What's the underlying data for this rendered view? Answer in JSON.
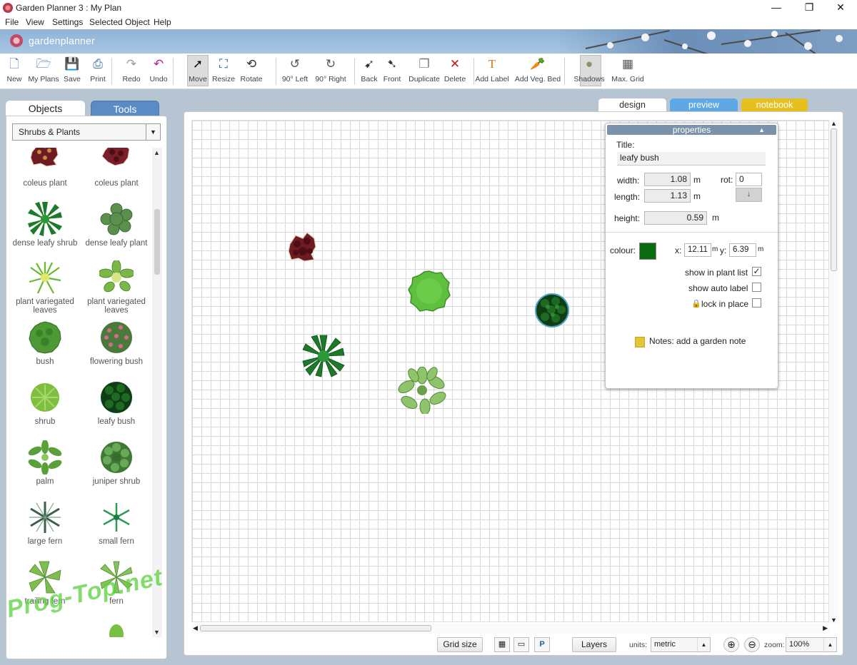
{
  "window": {
    "title": "Garden Planner 3 : My  Plan",
    "minimize": "—",
    "maximize": "❐",
    "close": "✕"
  },
  "menu": [
    "File",
    "View",
    "Settings",
    "Selected Object",
    "Help"
  ],
  "brand": {
    "logo_text": "gardenplanner"
  },
  "toolbar": [
    {
      "label": "New",
      "icon": "new-document-icon",
      "glyph": "🗋"
    },
    {
      "label": "My Plans",
      "icon": "folder-icon",
      "glyph": "🗁"
    },
    {
      "label": "Save",
      "icon": "save-icon",
      "glyph": "💾"
    },
    {
      "label": "Print",
      "icon": "print-icon",
      "glyph": "⎙"
    },
    {
      "label": "Redo",
      "icon": "redo-icon",
      "glyph": "↷"
    },
    {
      "label": "Undo",
      "icon": "undo-icon",
      "glyph": "↶"
    },
    {
      "label": "Move",
      "icon": "move-cursor-icon",
      "glyph": "➚",
      "selected": true
    },
    {
      "label": "Resize",
      "icon": "resize-icon",
      "glyph": "⛶"
    },
    {
      "label": "Rotate",
      "icon": "rotate-icon",
      "glyph": "⟲"
    },
    {
      "label": "90° Left",
      "icon": "rotate-left-icon",
      "glyph": "↺"
    },
    {
      "label": "90° Right",
      "icon": "rotate-right-icon",
      "glyph": "↻"
    },
    {
      "label": "Back",
      "icon": "send-back-icon",
      "glyph": "➹"
    },
    {
      "label": "Front",
      "icon": "bring-front-icon",
      "glyph": "➷"
    },
    {
      "label": "Duplicate",
      "icon": "duplicate-icon",
      "glyph": "❐"
    },
    {
      "label": "Delete",
      "icon": "delete-icon",
      "glyph": "✕"
    },
    {
      "label": "Add Label",
      "icon": "text-label-icon",
      "glyph": "T"
    },
    {
      "label": "Add Veg. Bed",
      "icon": "veg-bed-icon",
      "glyph": "🥕"
    },
    {
      "label": "Shadows",
      "icon": "shadows-icon",
      "glyph": "●",
      "selected": true
    },
    {
      "label": "Max. Grid",
      "icon": "max-grid-icon",
      "glyph": "▦"
    }
  ],
  "left_panel": {
    "tabs": [
      "Objects",
      "Tools"
    ],
    "category": "Shrubs & Plants",
    "items": [
      {
        "label": "coleus plant",
        "style": "coleus"
      },
      {
        "label": "coleus plant",
        "style": "coleus2"
      },
      {
        "label": "dense leafy shrub",
        "style": "spiky"
      },
      {
        "label": "dense leafy plant",
        "style": "leafy"
      },
      {
        "label": "plant variegated leaves",
        "style": "fan"
      },
      {
        "label": "plant variegated leaves",
        "style": "star"
      },
      {
        "label": "bush",
        "style": "bush"
      },
      {
        "label": "flowering bush",
        "style": "flowering"
      },
      {
        "label": "shrub",
        "style": "shrub"
      },
      {
        "label": "leafy bush",
        "style": "darkbush"
      },
      {
        "label": "palm",
        "style": "palm"
      },
      {
        "label": "juniper shrub",
        "style": "juniper"
      },
      {
        "label": "large fern",
        "style": "largefern"
      },
      {
        "label": "small fern",
        "style": "smallfern"
      },
      {
        "label": "trailing fern",
        "style": "trailing"
      },
      {
        "label": "fern",
        "style": "fern"
      }
    ]
  },
  "watermark": "Prog-Top.net",
  "view_tabs": [
    "design",
    "preview",
    "notebook"
  ],
  "colors": {
    "leafy_bush": "#0a6b12",
    "preview_tab": "#5fa8e4",
    "notebook_tab": "#e6c01e",
    "tools_tab": "#5b8bc4",
    "props_header": "#7a93ab"
  },
  "properties": {
    "header": "properties",
    "title_label": "Title:",
    "title_value": "leafy bush",
    "width_label": "width:",
    "width_value": "1.08",
    "length_label": "length:",
    "length_value": "1.13",
    "height_label": "height:",
    "height_value": "0.59",
    "unit_m": "m",
    "rot_label": "rot:",
    "rot_value": "0",
    "colour_label": "colour:",
    "x_label": "x:",
    "x_value": "12.11",
    "y_label": "y:",
    "y_value": "6.39",
    "show_in_plant_list": {
      "label": "show in plant list",
      "checked": true
    },
    "show_auto_label": {
      "label": "show auto label",
      "checked": false
    },
    "lock_in_place": {
      "label": "lock in place",
      "checked": false
    },
    "notes_label": "Notes: add a garden note"
  },
  "bottom_bar": {
    "grid_size": "Grid size",
    "layers": "Layers",
    "units_label": "units:",
    "units_value": "metric",
    "zoom_label": "zoom:",
    "zoom_value": "100%",
    "p_button": "P"
  }
}
